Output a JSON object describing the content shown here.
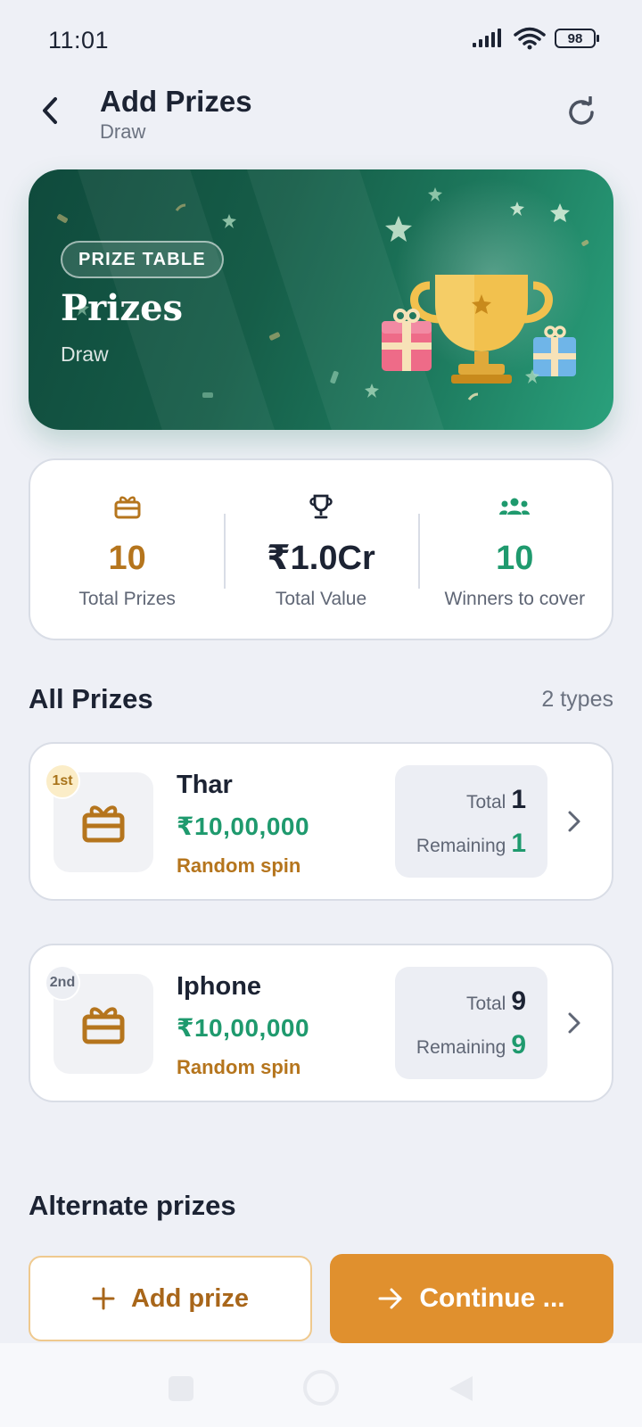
{
  "status_bar": {
    "time": "11:01",
    "battery": "98"
  },
  "header": {
    "title": "Add Prizes",
    "subtitle": "Draw"
  },
  "hero": {
    "badge": "PRIZE TABLE",
    "title": "Prizes",
    "subtitle": "Draw"
  },
  "stats": [
    {
      "icon": "gift-icon",
      "value": "10",
      "label": "Total Prizes",
      "color": "#b5751d"
    },
    {
      "icon": "trophy-icon",
      "value": "₹1.0Cr",
      "label": "Total Value",
      "color": "#1c2333"
    },
    {
      "icon": "users-icon",
      "value": "10",
      "label": "Winners to cover",
      "color": "#1f9a6e"
    }
  ],
  "all_prizes": {
    "title": "All Prizes",
    "count": "2 types",
    "items": [
      {
        "rank": "1st",
        "name": "Thar",
        "value": "₹10,00,000",
        "mode": "Random spin",
        "total_label": "Total",
        "total": "1",
        "remaining_label": "Remaining",
        "remaining": "1"
      },
      {
        "rank": "2nd",
        "name": "Iphone",
        "value": "₹10,00,000",
        "mode": "Random spin",
        "total_label": "Total",
        "total": "9",
        "remaining_label": "Remaining",
        "remaining": "9"
      }
    ]
  },
  "alternate": {
    "title": "Alternate prizes"
  },
  "actions": {
    "add_label": "Add prize",
    "continue_label": "Continue ..."
  },
  "colors": {
    "accent": "#e0902e",
    "green": "#1f9a6e",
    "gold": "#b5751d"
  }
}
